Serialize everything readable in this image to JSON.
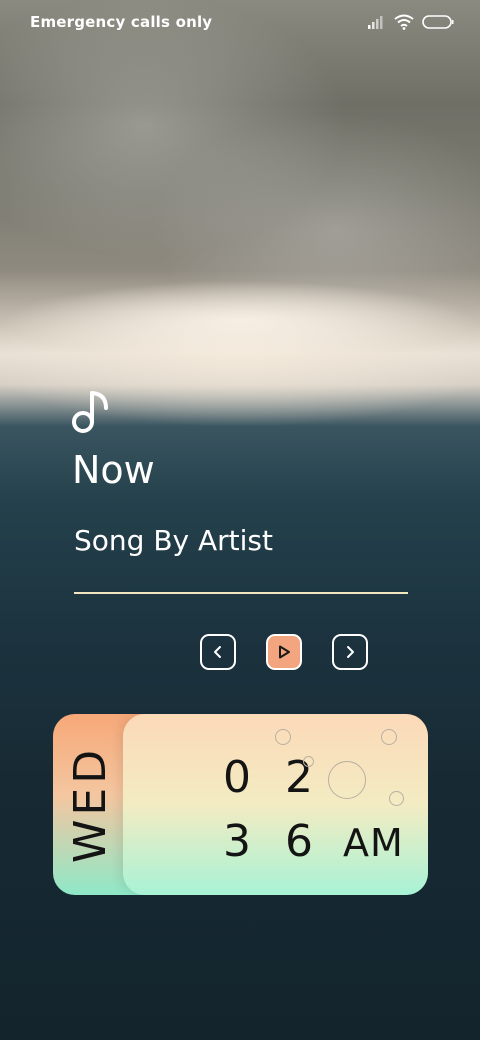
{
  "status_bar": {
    "carrier_text": "Emergency calls only",
    "icons": [
      "signal-icon",
      "wifi-icon",
      "battery-icon"
    ]
  },
  "music": {
    "icon": "music-note-icon",
    "heading": "Now",
    "track": "Song By Artist",
    "controls": [
      "previous-icon",
      "play-icon",
      "next-icon"
    ]
  },
  "clock_card": {
    "day": "WED",
    "hour": "0 2",
    "minute": "3 6",
    "ampm": "AM"
  },
  "colors": {
    "accent": "#f2a57e",
    "divider": "#f0e6c0",
    "card_top": "#fcd9b8",
    "card_bottom": "#a8f2d6"
  }
}
